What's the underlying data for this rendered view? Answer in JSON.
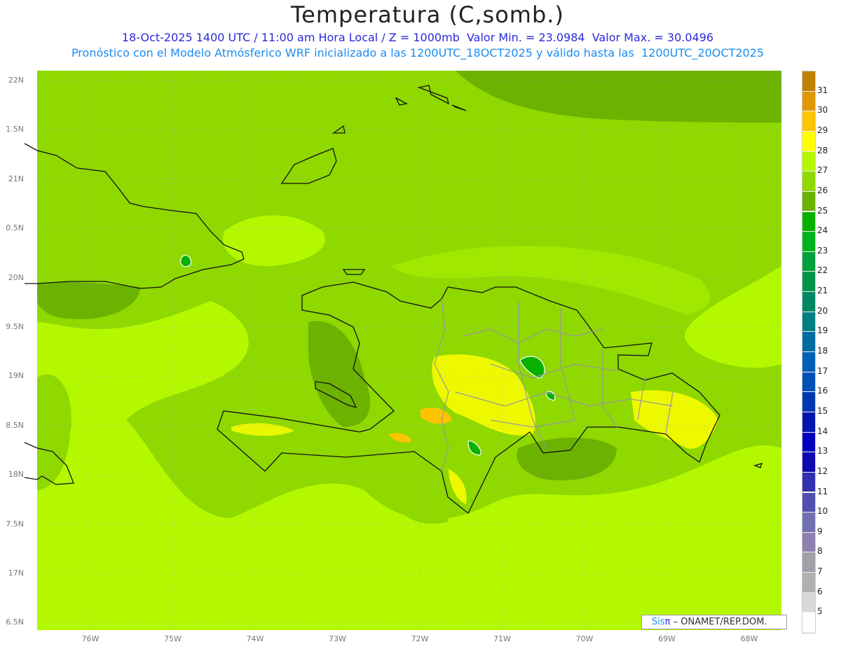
{
  "header": {
    "title": "Temperatura (C,somb.)",
    "line1": "18-Oct-2025 1400 UTC / 11:00 am Hora Local / Z = 1000mb  Valor Min. = 23.0984  Valor Max. = 30.0496",
    "line2": "Pronóstico con el Modelo Atmósferico WRF inicializado a las 1200UTC_18OCT2025 y válido hasta las  1200UTC_20OCT2025"
  },
  "axes": {
    "lat_labels": [
      "22N",
      "1.5N",
      "21N",
      "0.5N",
      "20N",
      "9.5N",
      "19N",
      "8.5N",
      "18N",
      "7.5N",
      "17N",
      "6.5N"
    ],
    "lon_labels": [
      "76W",
      "75W",
      "74W",
      "73W",
      "72W",
      "71W",
      "70W",
      "69W",
      "68W"
    ]
  },
  "colorbar": {
    "labels": [
      "31",
      "30",
      "29",
      "28",
      "27",
      "26",
      "25",
      "24",
      "23",
      "22",
      "21",
      "20",
      "19",
      "18",
      "17",
      "16",
      "15",
      "14",
      "13",
      "12",
      "11",
      "10",
      "9",
      "8",
      "7",
      "6",
      "5"
    ],
    "colors": [
      "#c08000",
      "#e09800",
      "#ffc400",
      "#ffff00",
      "#b4f800",
      "#8fd800",
      "#6cb200",
      "#08b000",
      "#00b41e",
      "#00a03a",
      "#009448",
      "#008864",
      "#008080",
      "#006ea0",
      "#0060b8",
      "#0050b8",
      "#0038b0",
      "#0018b0",
      "#0000c0",
      "#1008b0",
      "#3030b0",
      "#5050b0",
      "#7070b0",
      "#9080b0",
      "#a0a0a8",
      "#b0b0b0",
      "#d8d8d8",
      "#ffffff"
    ]
  },
  "credit": {
    "sis": "Sis",
    "pi": "π",
    "org": " – ONAMET/REP.DOM."
  }
}
